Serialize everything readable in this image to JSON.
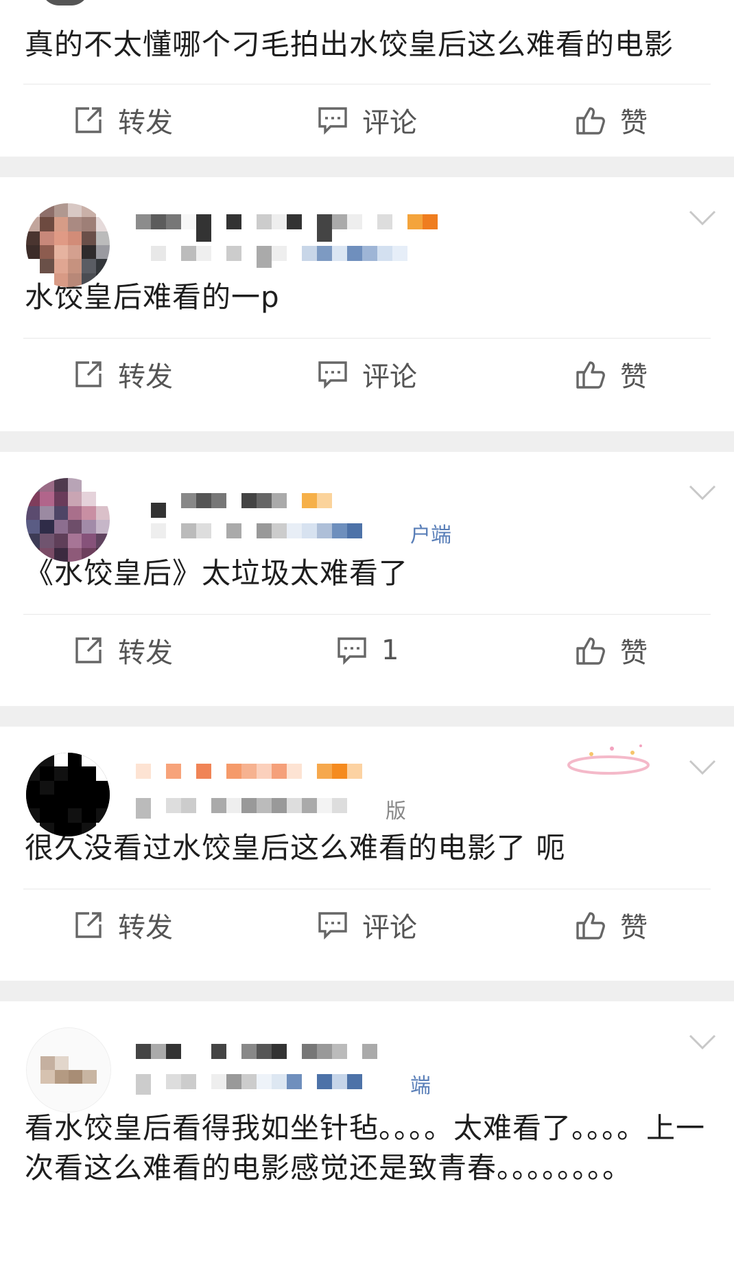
{
  "posts": [
    {
      "content": "真的不太懂哪个刁毛拍出水饺皇后这么难看的电影",
      "actions": {
        "repost": "转发",
        "comment": "评论",
        "like": "赞"
      }
    },
    {
      "content": "水饺皇后难看的一p",
      "actions": {
        "repost": "转发",
        "comment": "评论",
        "like": "赞"
      }
    },
    {
      "content": "《水饺皇后》太垃圾太难看了",
      "source_tail": "户端",
      "actions": {
        "repost": "转发",
        "comment": "1",
        "like": "赞"
      }
    },
    {
      "content": "很久没看过水饺皇后这么难看的电影了 呃",
      "source_tail": "版",
      "actions": {
        "repost": "转发",
        "comment": "评论",
        "like": "赞"
      }
    },
    {
      "content": "看水饺皇后看得我如坐针毡。。。。太难看了。。。。上一次看这么难看的电影感觉还是致青春。。。。。。。。",
      "source_tail": "端"
    }
  ],
  "icons": {
    "repost": "repost-icon",
    "comment": "comment-icon",
    "like": "thumbs-up-icon",
    "more": "chevron-down-icon"
  },
  "colors": {
    "background": "#efefef",
    "card": "#ffffff",
    "text": "#1e1e1e",
    "action_text": "#555555",
    "link_blue": "#5a7fb8"
  }
}
